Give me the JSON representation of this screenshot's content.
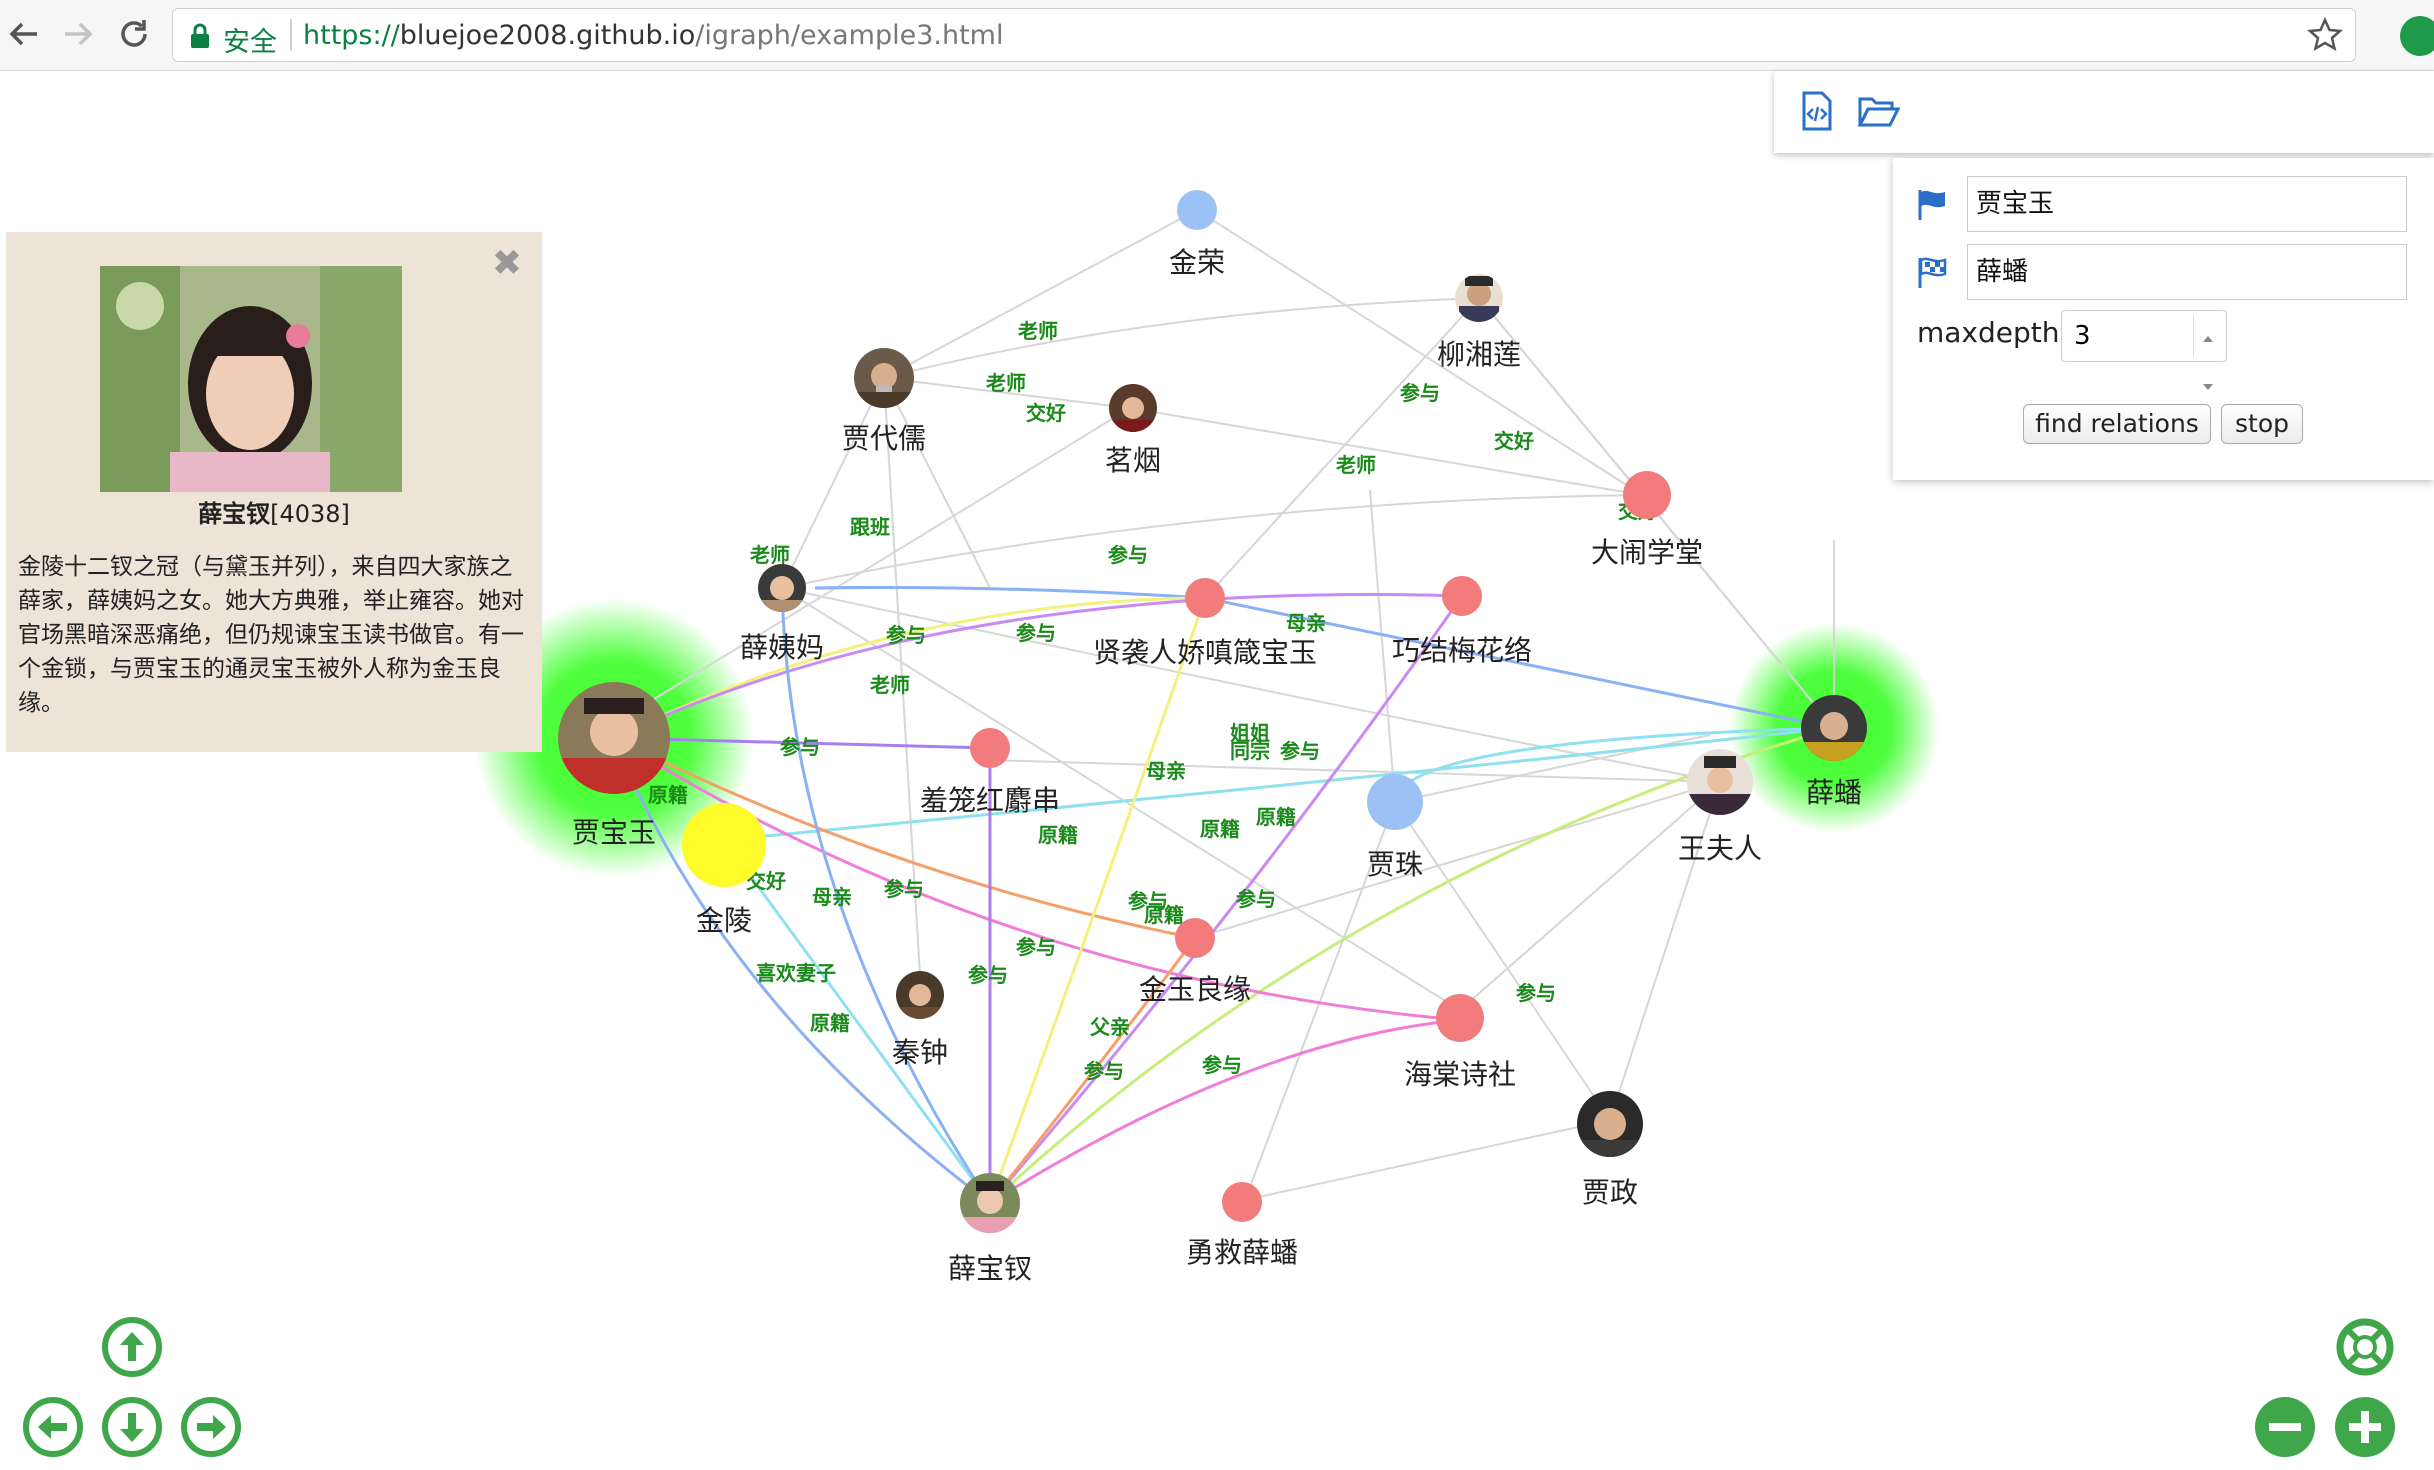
{
  "browser": {
    "secure_label": "安全",
    "url_scheme": "https://",
    "url_host": "bluejoe2008.github.io",
    "url_path": "/igraph/example3.html"
  },
  "search": {
    "start_value": "贾宝玉",
    "end_value": "薛蟠",
    "maxdepth_label": "maxdepth:",
    "maxdepth_value": "3",
    "find_button": "find relations",
    "stop_button": "stop"
  },
  "info": {
    "name": "薛宝钗",
    "id": "[4038]",
    "description": "金陵十二钗之冠（与黛玉并列），来自四大家族之薛家，薛姨妈之女。她大方典雅，举止雍容。她对官场黑暗深恶痛绝，但仍规谏宝玉读书做官。有一个金锁，与贾宝玉的通灵宝玉被外人称为金玉良缘。"
  },
  "colors": {
    "highlight_glow": "#3dff2a",
    "event_node": "#f27b7b",
    "place_node": "#fffa2a",
    "person_node_blue": "#9cc2f5",
    "edge_label": "#1a8a1a"
  },
  "graph": {
    "nodes": [
      {
        "id": "jinrong",
        "label": "金荣",
        "kind": "circle"
      },
      {
        "id": "liuxianglian",
        "label": "柳湘莲",
        "kind": "photo"
      },
      {
        "id": "jiadairu",
        "label": "贾代儒",
        "kind": "photo"
      },
      {
        "id": "mingyan",
        "label": "茗烟",
        "kind": "photo"
      },
      {
        "id": "danao",
        "label": "大闹学堂",
        "kind": "event"
      },
      {
        "id": "xueyima",
        "label": "薛姨妈",
        "kind": "photo"
      },
      {
        "id": "xianxiren",
        "label": "贤袭人娇嗔箴宝玉",
        "kind": "event"
      },
      {
        "id": "qiaojie",
        "label": "巧结梅花络",
        "kind": "event"
      },
      {
        "id": "jiabaoyu",
        "label": "贾宝玉",
        "kind": "photo-highlight"
      },
      {
        "id": "xuepan",
        "label": "薛蟠",
        "kind": "photo-highlight"
      },
      {
        "id": "xiulong",
        "label": "羞笼红麝串",
        "kind": "event"
      },
      {
        "id": "jiazhu",
        "label": "贾珠",
        "kind": "circle"
      },
      {
        "id": "wangfuren",
        "label": "王夫人",
        "kind": "photo"
      },
      {
        "id": "jinling",
        "label": "金陵",
        "kind": "place"
      },
      {
        "id": "jinyu",
        "label": "金玉良缘",
        "kind": "event"
      },
      {
        "id": "qinzhong",
        "label": "秦钟",
        "kind": "photo"
      },
      {
        "id": "haitang",
        "label": "海棠诗社",
        "kind": "event"
      },
      {
        "id": "jiazheng",
        "label": "贾政",
        "kind": "photo"
      },
      {
        "id": "xuebaochai",
        "label": "薛宝钗",
        "kind": "photo"
      },
      {
        "id": "yongjiu",
        "label": "勇救薛蟠",
        "kind": "event"
      }
    ],
    "edge_labels": [
      "老师",
      "老师",
      "交好",
      "参与",
      "交好",
      "老师",
      "交好",
      "跟班",
      "老师",
      "参与",
      "参与",
      "参与",
      "母亲",
      "老师",
      "参与",
      "姐姐",
      "同宗",
      "参与",
      "母亲",
      "原籍",
      "原籍",
      "原籍",
      "原籍",
      "交好",
      "母亲",
      "参与",
      "参与",
      "原籍",
      "参与",
      "参与",
      "参与",
      "喜欢妻子",
      "原籍",
      "父亲",
      "参与",
      "参与",
      "参与"
    ]
  }
}
